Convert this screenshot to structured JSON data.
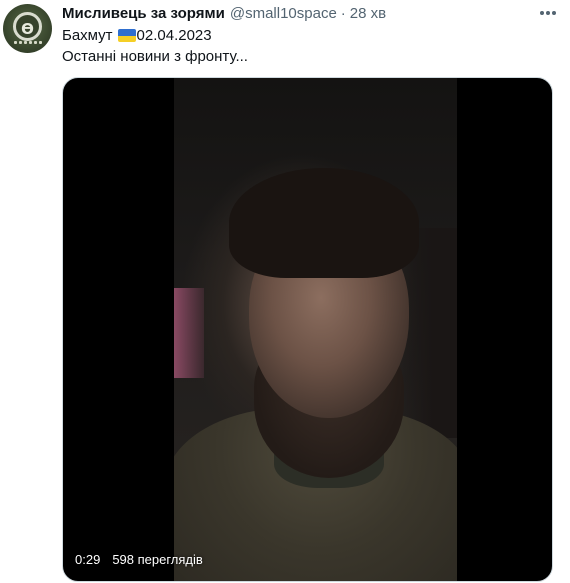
{
  "author": {
    "display_name": "Мисливець за зорями",
    "handle": "@small10space",
    "separator": "·",
    "time": "28 хв",
    "avatar_icon": "round-patch-emblem"
  },
  "tweet": {
    "text_location": "Бахмут",
    "flag_icon": "ukraine-flag",
    "text_date": "02.04.2023",
    "text_line2": "Останні новини з фронту..."
  },
  "video": {
    "duration": "0:29",
    "views": "598 переглядів"
  },
  "colors": {
    "name_text": "#0f1419",
    "secondary_text": "#536471",
    "flag_blue": "#2f6fcf",
    "flag_yellow": "#f5cf26"
  }
}
